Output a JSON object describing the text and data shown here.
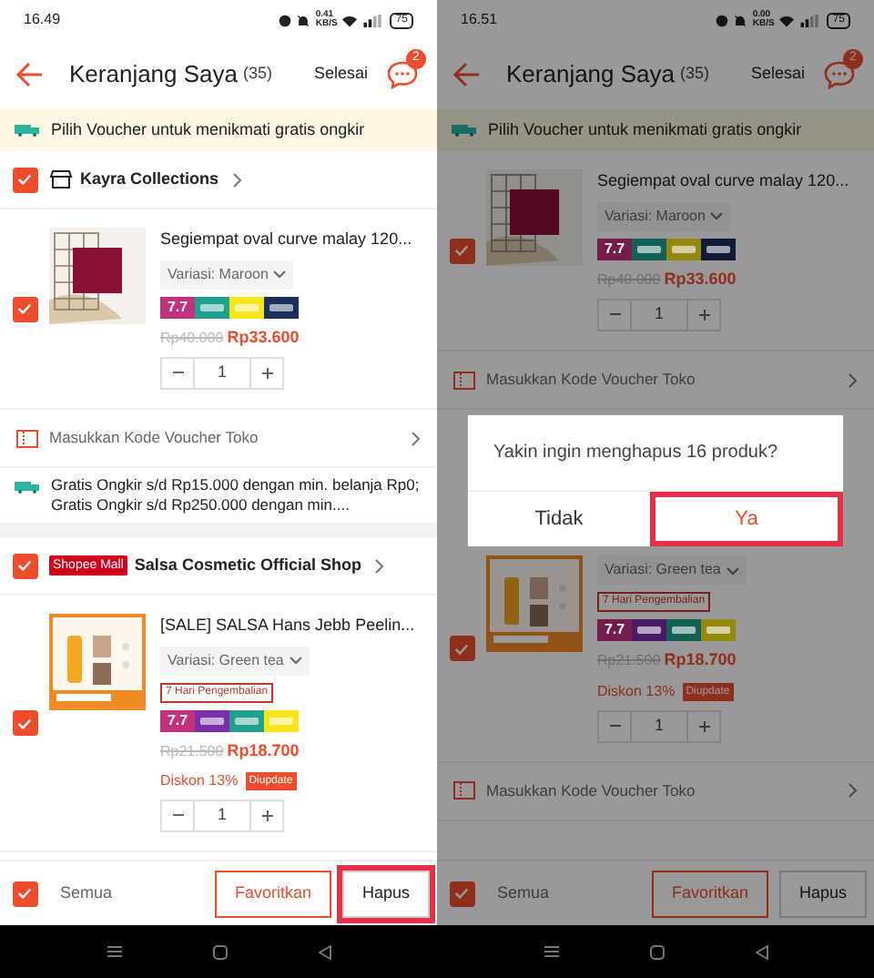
{
  "screens": [
    {
      "status_bar": {
        "time": "16.49",
        "speed": "0.41",
        "speed_unit": "KB/S",
        "battery": "75"
      },
      "header": {
        "title": "Keranjang Saya",
        "count": "(35)",
        "action": "Selesai",
        "chat_badge": "2"
      },
      "voucher_banner": "Pilih Voucher untuk menikmati gratis ongkir",
      "sections": [
        {
          "kind": "shop",
          "checked": true,
          "name": "Kayra Collections"
        },
        {
          "kind": "product",
          "checked": true,
          "title": "Segiempat oval curve malay 120...",
          "variant": "Variasi: Maroon",
          "promos": [
            {
              "color": "#c2307e",
              "label": "7.7"
            },
            {
              "color": "#21a08e"
            },
            {
              "color": "#f5e51a"
            },
            {
              "color": "#1b2f5c"
            }
          ],
          "old_price": "Rp40.000",
          "price": "Rp33.600",
          "quantity": "1"
        },
        {
          "kind": "voucher",
          "label": "Masukkan Kode Voucher Toko"
        },
        {
          "kind": "shipping",
          "text": "Gratis Ongkir s/d Rp15.000 dengan min. belanja Rp0; Gratis Ongkir s/d Rp250.000 dengan min...."
        },
        {
          "kind": "shop",
          "checked": true,
          "mall": "Shopee Mall",
          "name": "Salsa Cosmetic Official Shop"
        },
        {
          "kind": "product",
          "checked": true,
          "title": "[SALE] SALSA Hans Jebb Peelin...",
          "variant": "Variasi: Green tea",
          "return_label": "7 Hari Pengembalian",
          "promos": [
            {
              "color": "#c2307e",
              "label": "7.7"
            },
            {
              "color": "#7b2fa8"
            },
            {
              "color": "#21a08e"
            },
            {
              "color": "#f5e51a"
            }
          ],
          "old_price": "Rp21.500",
          "price": "Rp18.700",
          "discount": "Diskon 13%",
          "updated": "Diupdate",
          "quantity": "1"
        }
      ],
      "bottom_bar": {
        "select_all": {
          "label": "Semua",
          "checked": true
        },
        "buttons": [
          {
            "label": "Favoritkan",
            "kind": "outline",
            "highlighted": false
          },
          {
            "label": "Hapus",
            "kind": "plain",
            "highlighted": true
          }
        ]
      }
    },
    {
      "status_bar": {
        "time": "16.51",
        "speed": "0.00",
        "speed_unit": "KB/S",
        "battery": "75"
      },
      "header": {
        "title": "Keranjang Saya",
        "count": "(35)",
        "action": "Selesai",
        "chat_badge": "2"
      },
      "voucher_banner": "Pilih Voucher untuk menikmati gratis ongkir",
      "sections": [
        {
          "kind": "product",
          "checked": true,
          "title": "Segiempat oval curve malay 120...",
          "variant": "Variasi: Maroon",
          "promos": [
            {
              "color": "#741d4c",
              "label": "7.7"
            },
            {
              "color": "#146055"
            },
            {
              "color": "#938910"
            },
            {
              "color": "#101c37"
            }
          ],
          "old_price": "Rp40.000",
          "price": "Rp33.600",
          "quantity": "1"
        },
        {
          "kind": "voucher",
          "label": "Masukkan Kode Voucher Toko"
        },
        {
          "kind": "gap"
        },
        {
          "kind": "product",
          "checked": true,
          "variant": "Variasi: Green tea",
          "return_label": "7 Hari Pengembalian",
          "promos": [
            {
              "color": "#741d4c",
              "label": "7.7"
            },
            {
              "color": "#4a1c65"
            },
            {
              "color": "#146055"
            },
            {
              "color": "#938910"
            }
          ],
          "old_price": "Rp21.500",
          "price": "Rp18.700",
          "discount": "Diskon 13%",
          "updated": "Diupdate",
          "quantity": "1"
        },
        {
          "kind": "voucher",
          "label": "Masukkan Kode Voucher Toko"
        }
      ],
      "bottom_bar": {
        "select_all": {
          "label": "Semua",
          "checked": true
        },
        "buttons": [
          {
            "label": "Favoritkan",
            "kind": "outline",
            "highlighted": false
          },
          {
            "label": "Hapus",
            "kind": "plain",
            "highlighted": false
          }
        ]
      },
      "dialog": {
        "message": "Yakin ingin menghapus 16 produk?",
        "buttons": [
          {
            "label": "Tidak",
            "kind": "plain",
            "highlighted": false
          },
          {
            "label": "Ya",
            "kind": "primary",
            "highlighted": true
          }
        ]
      }
    }
  ]
}
